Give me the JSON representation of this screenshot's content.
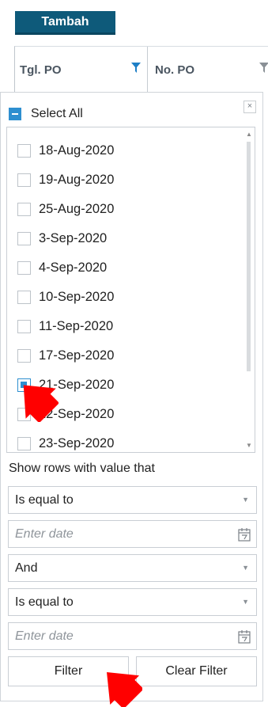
{
  "toolbar": {
    "add_label": "Tambah"
  },
  "grid_header": {
    "columns": [
      {
        "label": "Tgl. PO"
      },
      {
        "label": "No. PO"
      }
    ]
  },
  "filter_popup": {
    "select_all_label": "Select All",
    "close_icon": "×",
    "items": [
      {
        "label": "18-Aug-2020",
        "checked": false
      },
      {
        "label": "19-Aug-2020",
        "checked": false
      },
      {
        "label": "25-Aug-2020",
        "checked": false
      },
      {
        "label": "3-Sep-2020",
        "checked": false
      },
      {
        "label": "4-Sep-2020",
        "checked": false
      },
      {
        "label": "10-Sep-2020",
        "checked": false
      },
      {
        "label": "11-Sep-2020",
        "checked": false
      },
      {
        "label": "17-Sep-2020",
        "checked": false
      },
      {
        "label": "21-Sep-2020",
        "checked": true
      },
      {
        "label": "22-Sep-2020",
        "checked": false
      },
      {
        "label": "23-Sep-2020",
        "checked": false
      }
    ],
    "show_rows_label": "Show rows with value that",
    "condition1": "Is equal to",
    "date1_placeholder": "Enter date",
    "logic_operator": "And",
    "condition2": "Is equal to",
    "date2_placeholder": "Enter date",
    "filter_button": "Filter",
    "clear_filter_button": "Clear Filter"
  },
  "colors": {
    "accent": "#0e5a7a",
    "checkbox_blue": "#2e8fd0",
    "funnel_blue": "#1e7fc6",
    "annotation_red": "#ff0000"
  }
}
